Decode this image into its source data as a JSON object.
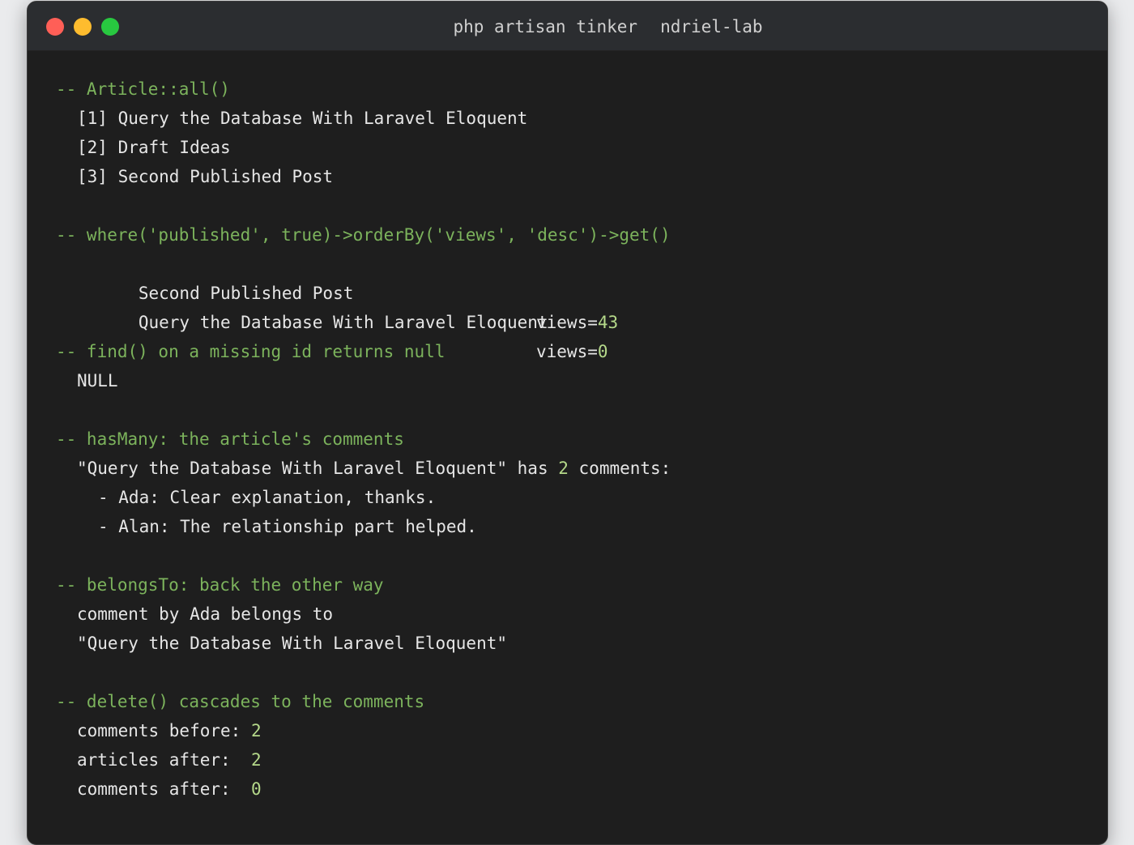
{
  "window": {
    "title_cmd": "php artisan tinker",
    "title_host": "ndriel-lab"
  },
  "sections": {
    "all": {
      "comment": "-- Article::all()",
      "rows": [
        "[1] Query the Database With Laravel Eloquent",
        "[2] Draft Ideas",
        "[3] Second Published Post"
      ]
    },
    "where": {
      "comment": "-- where('published', true)->orderBy('views', 'desc')->get()",
      "rows": [
        {
          "title": "Second Published Post",
          "views_label": "views=",
          "views": "43"
        },
        {
          "title": "Query the Database With Laravel Eloquent",
          "views_label": "views=",
          "views": "0"
        }
      ]
    },
    "find": {
      "comment": "-- find() on a missing id returns null",
      "result": "NULL"
    },
    "hasmany": {
      "comment": "-- hasMany: the article's comments",
      "summary_title": "\"Query the Database With Laravel Eloquent\"",
      "summary_has": " has ",
      "summary_count": "2",
      "summary_tail": " comments:",
      "items": [
        "- Ada: Clear explanation, thanks.",
        "- Alan: The relationship part helped."
      ]
    },
    "belongsto": {
      "comment": "-- belongsTo: back the other way",
      "line1": "comment by Ada belongs to",
      "line2": "\"Query the Database With Laravel Eloquent\""
    },
    "delete": {
      "comment": "-- delete() cascades to the comments",
      "rows": [
        {
          "label": "comments before: ",
          "value": "2"
        },
        {
          "label": "articles after:  ",
          "value": "2"
        },
        {
          "label": "comments after:  ",
          "value": "0"
        }
      ]
    }
  },
  "colors": {
    "background": "#1e1e1e",
    "comment": "#7cb35c",
    "text": "#e6e6e6",
    "number": "#b5d98a"
  }
}
